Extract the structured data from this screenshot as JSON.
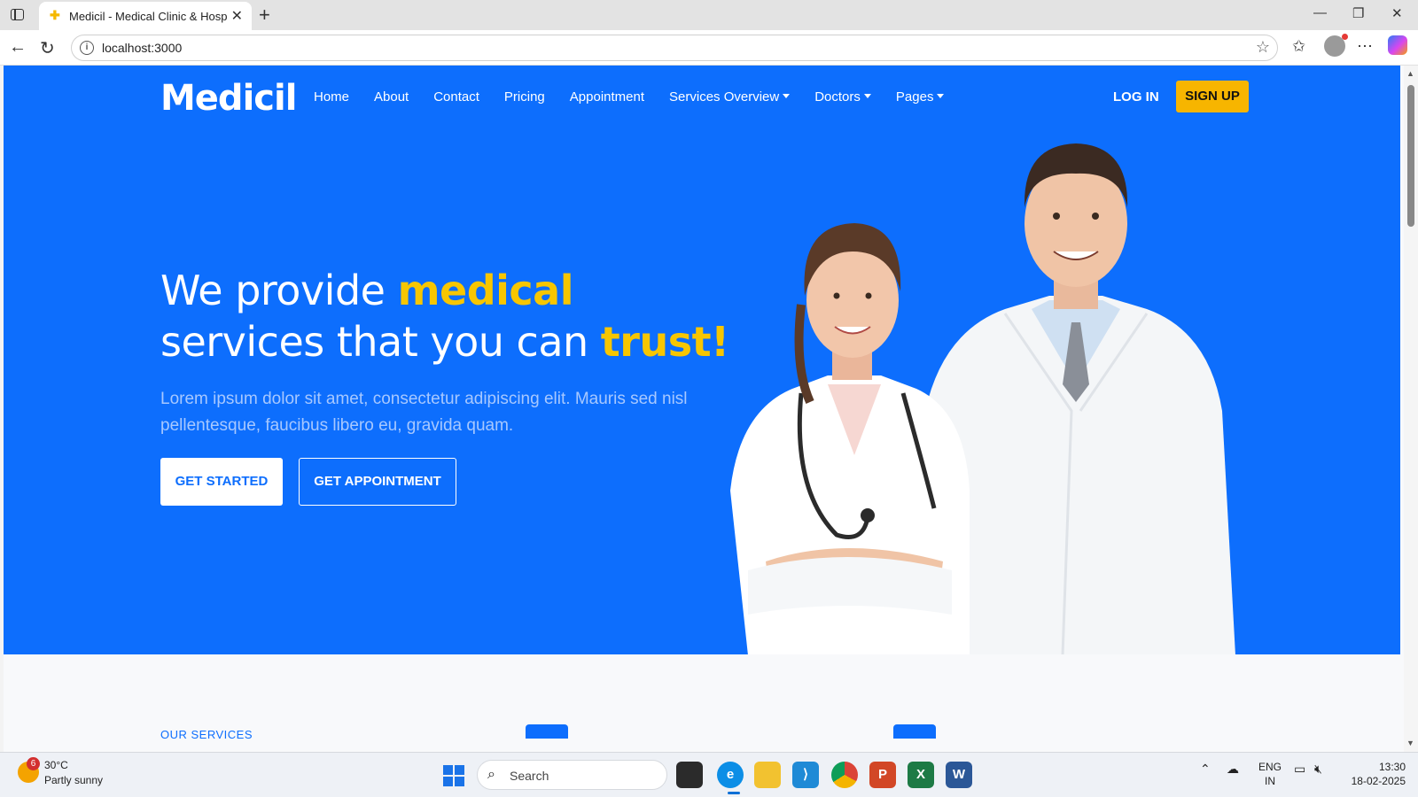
{
  "browser": {
    "tab_title": "Medicil - Medical Clinic & Hospital",
    "url": "localhost:3000"
  },
  "site": {
    "logo": "Medicil",
    "nav": [
      {
        "label": "Home"
      },
      {
        "label": "About"
      },
      {
        "label": "Contact"
      },
      {
        "label": "Pricing"
      },
      {
        "label": "Appointment"
      },
      {
        "label": "Services Overview",
        "dropdown": true
      },
      {
        "label": "Doctors",
        "dropdown": true
      },
      {
        "label": "Pages",
        "dropdown": true
      }
    ],
    "login": "LOG IN",
    "signup": "SIGN UP"
  },
  "hero": {
    "line1_plain": "We provide ",
    "line1_accent": "medical",
    "line2_plain": "services that you can ",
    "line2_accent": "trust!",
    "lede": "Lorem ipsum dolor sit amet, consectetur adipiscing elit. Mauris sed nisl pellentesque, faucibus libero eu, gravida quam.",
    "cta_primary": "GET STARTED",
    "cta_secondary": "GET APPOINTMENT"
  },
  "services": {
    "label": "OUR SERVICES"
  },
  "taskbar": {
    "weather_badge": "6",
    "weather_temp": "30°C",
    "weather_desc": "Partly sunny",
    "search_placeholder": "Search",
    "lang_line1": "ENG",
    "lang_line2": "IN",
    "time": "13:30",
    "date": "18-02-2025"
  },
  "colors": {
    "primary": "#0d6efd",
    "accent": "#f7b500"
  }
}
